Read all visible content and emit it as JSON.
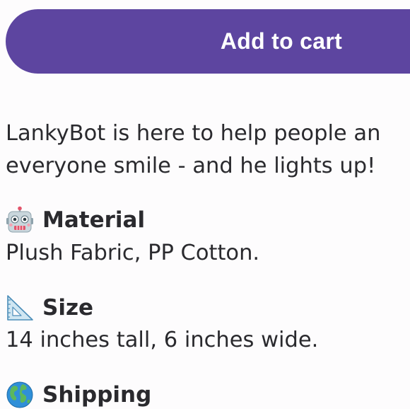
{
  "cart": {
    "button_label": "Add to cart",
    "accent_color": "#5d45a0"
  },
  "description": {
    "line1": "LankyBot is here to help people an",
    "line2": "everyone smile - and he lights up!"
  },
  "specs": [
    {
      "icon": "robot-face-icon",
      "heading": "Material",
      "value": "Plush Fabric, PP Cotton."
    },
    {
      "icon": "triangular-ruler-icon",
      "heading": "Size",
      "value": "14 inches tall, 6 inches wide."
    },
    {
      "icon": "globe-icon",
      "heading": "Shipping"
    }
  ]
}
